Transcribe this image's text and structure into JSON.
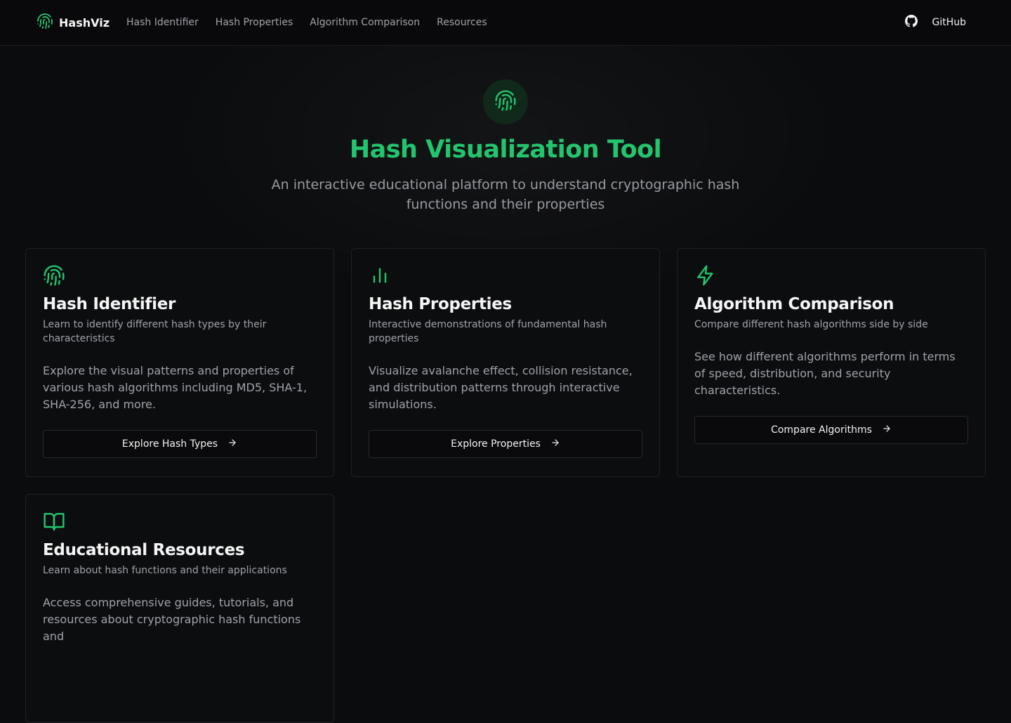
{
  "nav": {
    "brand": "HashViz",
    "links": [
      "Hash Identifier",
      "Hash Properties",
      "Algorithm Comparison",
      "Resources"
    ],
    "github_label": "GitHub"
  },
  "hero": {
    "title": "Hash Visualization Tool",
    "subtitle": "An interactive educational platform to understand cryptographic hash functions and their properties"
  },
  "cards": [
    {
      "icon": "fingerprint-icon",
      "title": "Hash Identifier",
      "desc": "Learn to identify different hash types by their characteristics",
      "body": "Explore the visual patterns and properties of various hash algorithms including MD5, SHA-1, SHA-256, and more.",
      "button": "Explore Hash Types"
    },
    {
      "icon": "bar-chart-icon",
      "title": "Hash Properties",
      "desc": "Interactive demonstrations of fundamental hash properties",
      "body": "Visualize avalanche effect, collision resistance, and distribution patterns through interactive simulations.",
      "button": "Explore Properties"
    },
    {
      "icon": "lightning-icon",
      "title": "Algorithm Comparison",
      "desc": "Compare different hash algorithms side by side",
      "body": "See how different algorithms perform in terms of speed, distribution, and security characteristics.",
      "button": "Compare Algorithms"
    },
    {
      "icon": "book-open-icon",
      "title": "Educational Resources",
      "desc": "Learn about hash functions and their applications",
      "body": "Access comprehensive guides, tutorials, and resources about cryptographic hash functions and",
      "button": ""
    }
  ],
  "colors": {
    "accent": "#22c56d",
    "background": "#0b0c0e",
    "card_border": "#1f2124"
  }
}
